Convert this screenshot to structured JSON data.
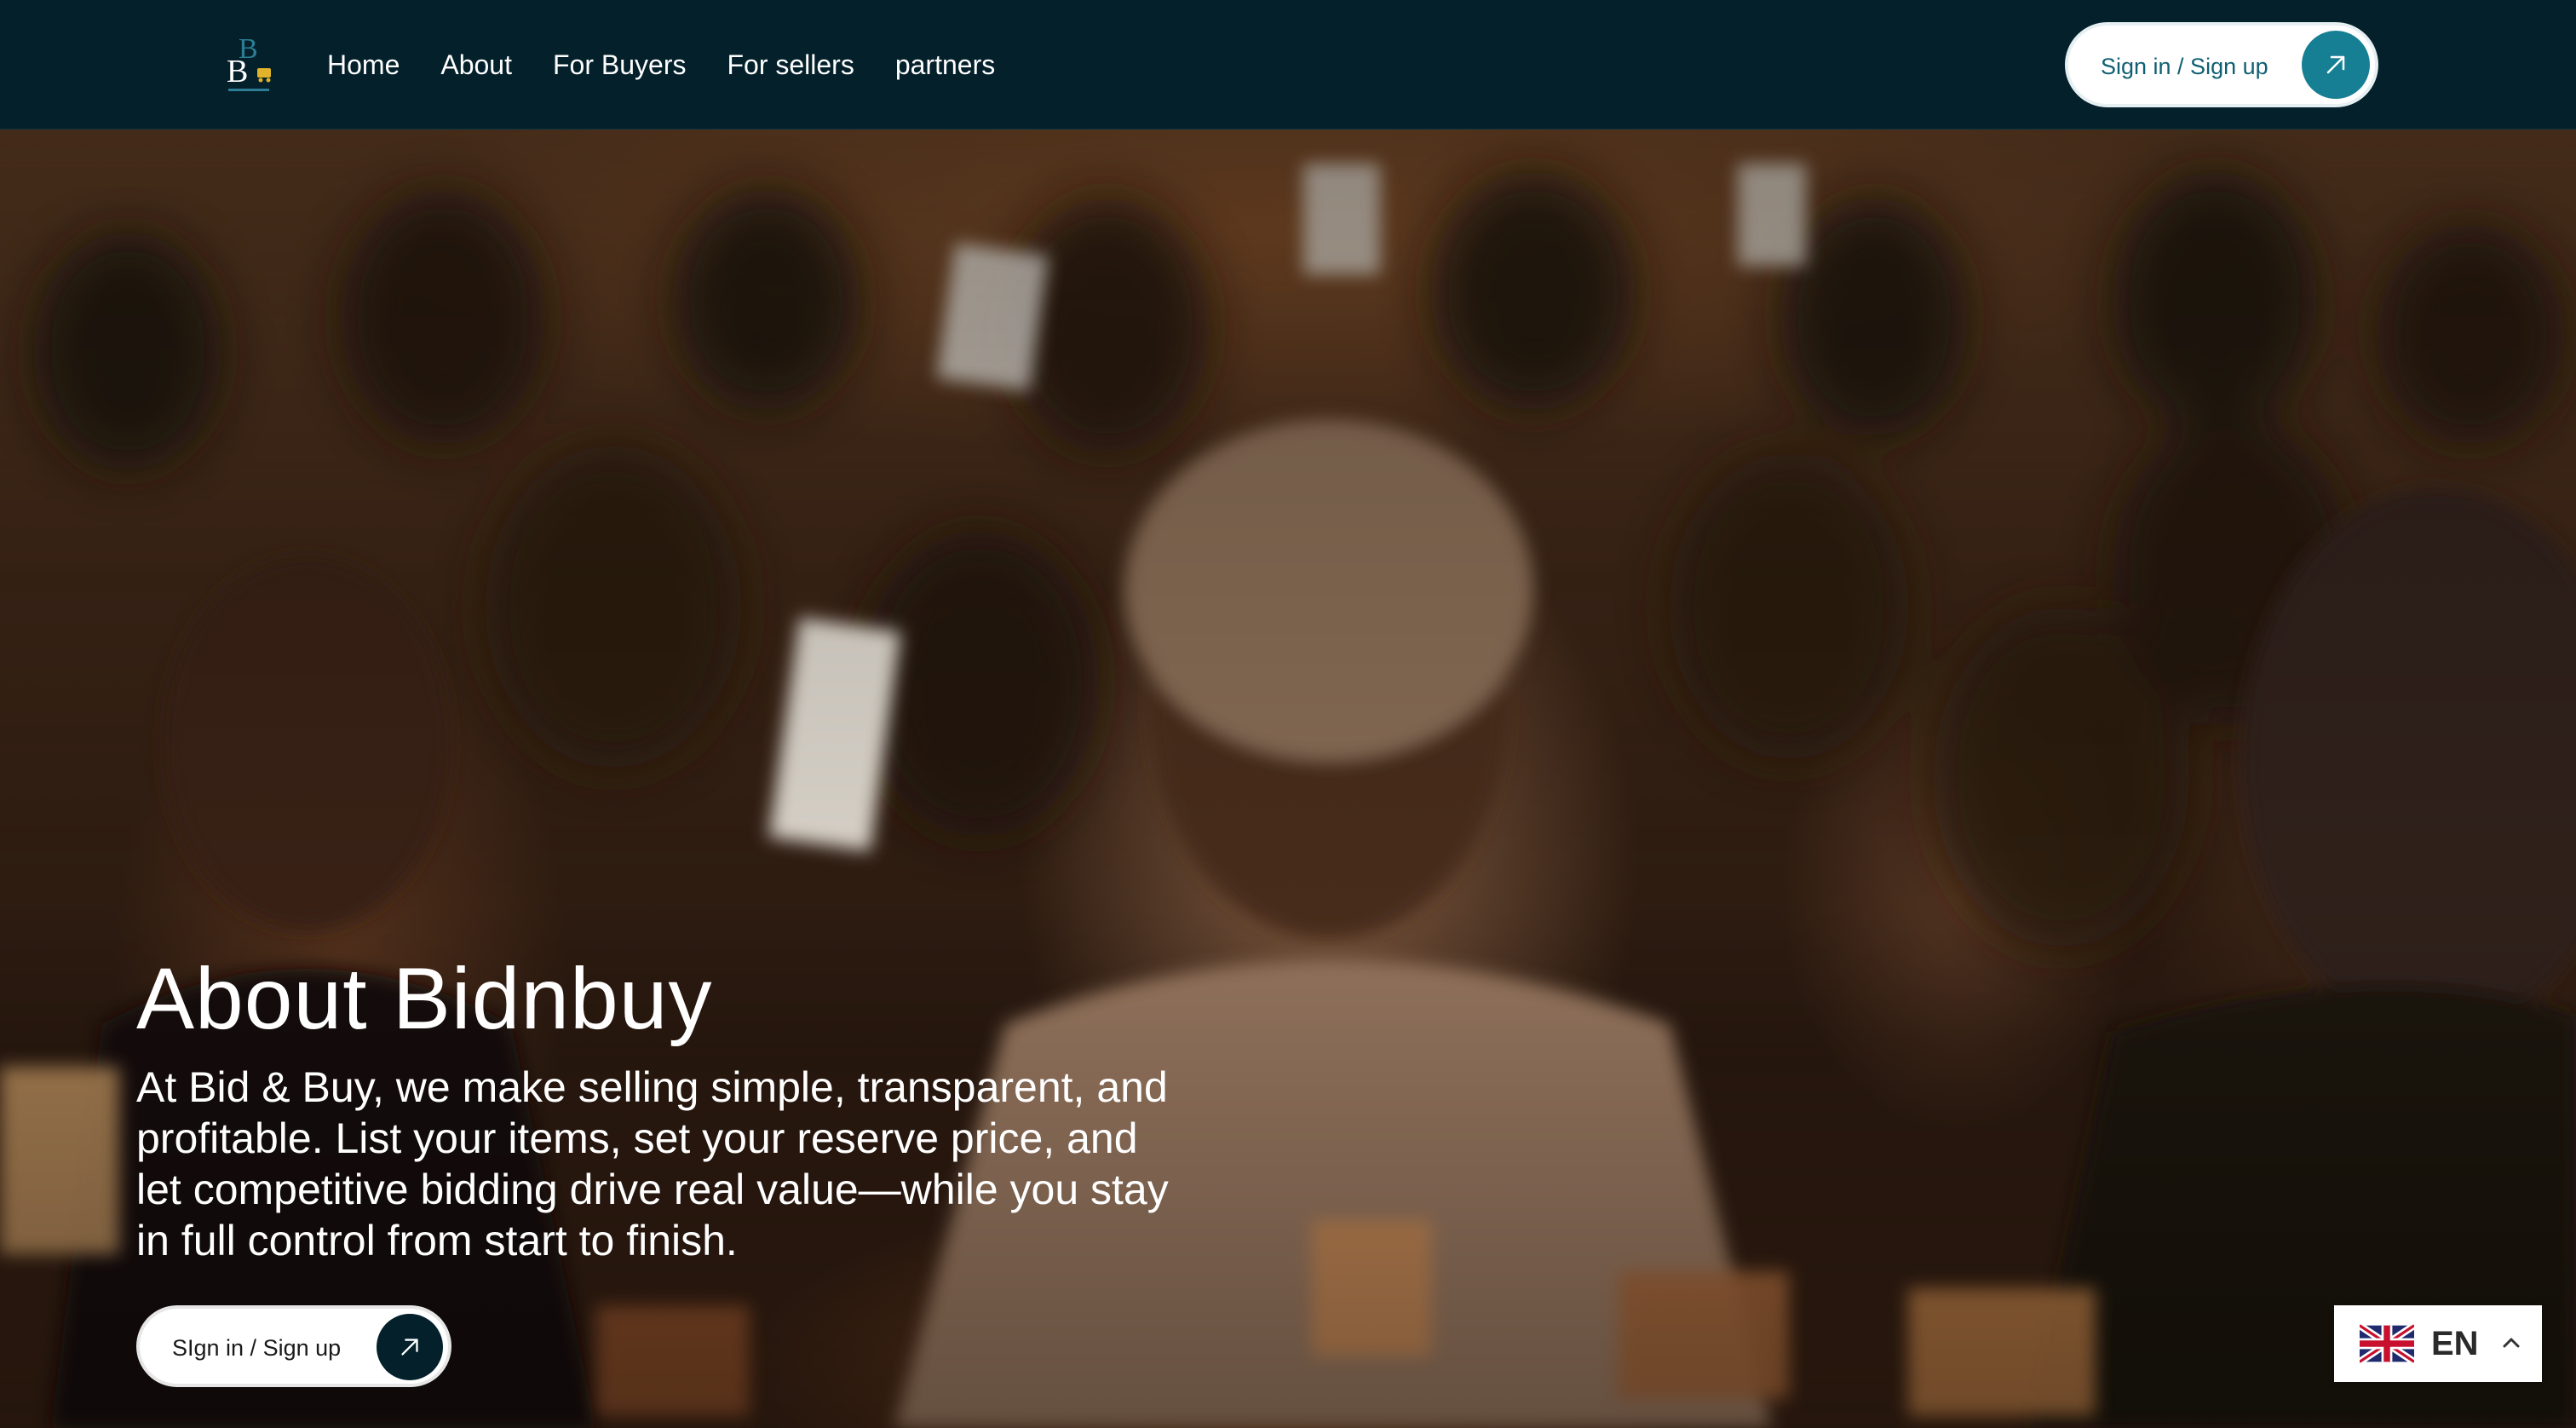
{
  "nav": {
    "logo_label": "Bidnbuy logo",
    "links": [
      {
        "label": "Home"
      },
      {
        "label": "About"
      },
      {
        "label": "For Buyers"
      },
      {
        "label": "For sellers"
      },
      {
        "label": "partners"
      }
    ],
    "cta_label": "Sign in / Sign up",
    "cta_icon": "arrow-up-right-icon"
  },
  "hero": {
    "title": "About Bidnbuy",
    "body": "At Bid & Buy, we make selling simple, transparent, and profitable. List your items, set your reserve price, and let competitive bidding drive real value—while you stay in full control from start to finish.",
    "cta_label": "SIgn in / Sign up",
    "cta_icon": "arrow-up-right-icon"
  },
  "language": {
    "code": "EN",
    "flag_icon": "uk-flag-icon",
    "chevron_icon": "chevron-up-icon"
  },
  "colors": {
    "nav_bg": "#03202b",
    "accent": "#167f93",
    "cta_text": "#0f5f72"
  }
}
